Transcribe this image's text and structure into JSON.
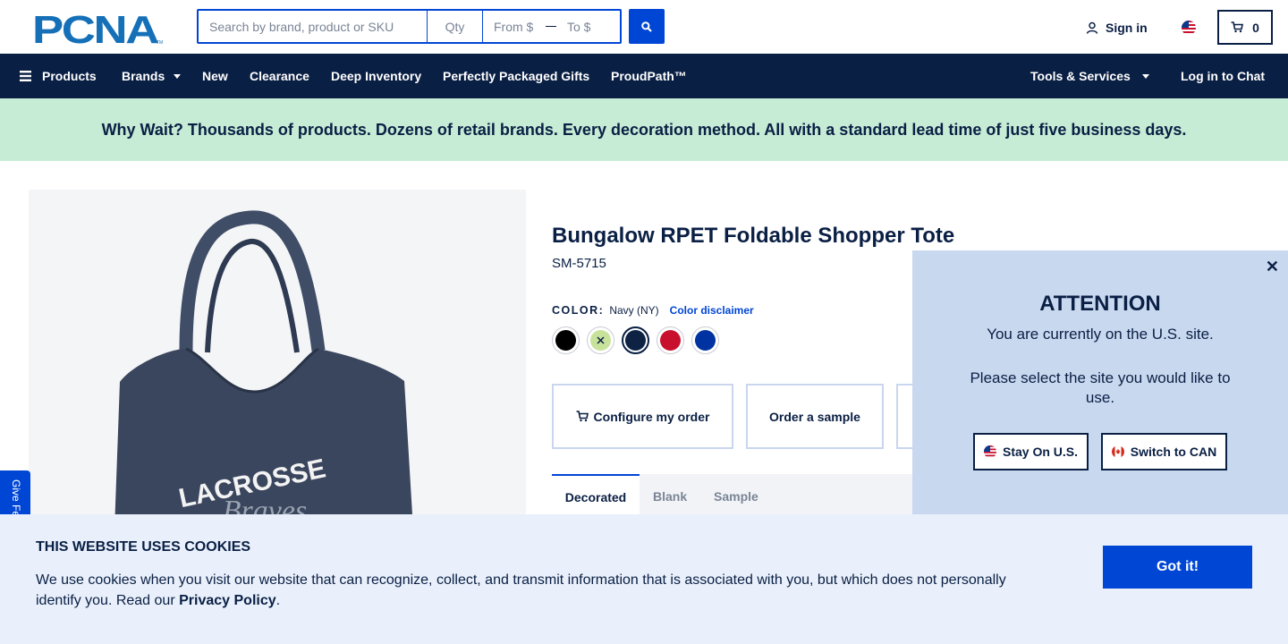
{
  "header": {
    "logo_text": "PCNA",
    "search_placeholder": "Search by brand, product or SKU",
    "qty_placeholder": "Qty",
    "from_placeholder": "From $",
    "to_placeholder": "To $",
    "signin_label": "Sign in",
    "cart_count": "0"
  },
  "nav": {
    "products": "Products",
    "brands": "Brands",
    "new": "New",
    "clearance": "Clearance",
    "deep_inventory": "Deep Inventory",
    "gifts": "Perfectly Packaged Gifts",
    "proudpath": "ProudPath™",
    "tools": "Tools & Services",
    "chat": "Log in to Chat"
  },
  "promo": "Why Wait? Thousands of products. Dozens of retail brands. Every decoration method. All with a standard lead time of just five business days.",
  "product": {
    "title": "Bungalow RPET Foldable Shopper Tote",
    "sku": "SM-5715",
    "color_label": "COLOR:",
    "color_value": "Navy (NY)",
    "color_disclaimer": "Color disclaimer",
    "image_text_1": "LACROSSE",
    "image_text_2": "Braves",
    "swatches": [
      {
        "name": "Black",
        "hex": "#000000"
      },
      {
        "name": "Lime",
        "hex": "#c8e29b"
      },
      {
        "name": "Navy",
        "hex": "#0e2244"
      },
      {
        "name": "Red",
        "hex": "#c8102e"
      },
      {
        "name": "Royal Blue",
        "hex": "#0033a1"
      }
    ],
    "configure_label": "Configure my order",
    "sample_label": "Order a sample",
    "tabs": [
      "Decorated",
      "Blank",
      "Sample"
    ]
  },
  "popup": {
    "heading": "ATTENTION",
    "line1": "You are currently on the U.S. site.",
    "line2": "Please select the site you would like to use.",
    "stay_label": "Stay On U.S.",
    "switch_label": "Switch to CAN"
  },
  "feedback_label": "Give Feedback",
  "cookie": {
    "heading": "THIS WEBSITE USES COOKIES",
    "text": "We use cookies when you visit our website that can recognize, collect, and transmit information that is associated with you, but which does not personally identify you. Read our",
    "link": "Privacy Policy",
    "period": ".",
    "button": "Got it!"
  },
  "colors": {
    "navy": "#0a1f44",
    "accent_blue": "#0046d5",
    "promo_green": "#c6ecd5",
    "popup_bg": "#c8d8ef",
    "cookie_bg": "#e9f0fb"
  }
}
